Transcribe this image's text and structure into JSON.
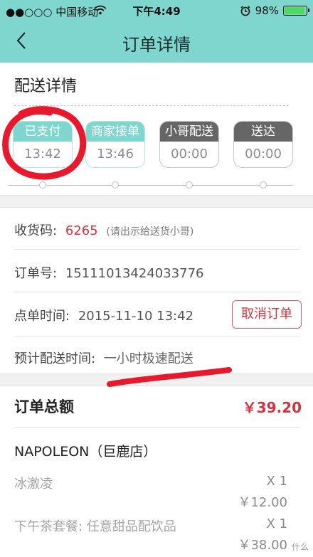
{
  "status_bar": {
    "carrier": "●●○○○ 中国移动",
    "time": "下午4:49",
    "battery_text": "98%",
    "battery_level": 0.98,
    "wifi_icon": "wifi-icon",
    "alarm_icon": "alarm-clock-icon"
  },
  "nav": {
    "title": "订单详情",
    "back_icon": "chevron-left-icon"
  },
  "delivery": {
    "section_title": "配送详情",
    "steps": [
      {
        "label": "已支付",
        "time": "13:42",
        "state": "done"
      },
      {
        "label": "商家接单",
        "time": "13:46",
        "state": "done"
      },
      {
        "label": "小哥配送",
        "time": "00:00",
        "state": "todo"
      },
      {
        "label": "送达",
        "time": "00:00",
        "state": "todo"
      }
    ]
  },
  "info": {
    "pickup_label": "收货码:",
    "pickup_code": "6265",
    "pickup_hint": "(请出示给送货小哥)",
    "order_no_label": "订单号:",
    "order_no": "15111013424033776",
    "order_time_label": "点单时间:",
    "order_time": "2015-11-10 13:42",
    "cancel_label": "取消订单",
    "eta_label": "预计配送时间:",
    "eta_value": "一小时极速配送"
  },
  "summary": {
    "total_label": "订单总额",
    "total_value": "￥39.20",
    "shop_name": "NAPOLEON（巨鹿店）",
    "items": [
      {
        "name": "冰激凌",
        "qty": "X 1",
        "price": "￥12.00"
      },
      {
        "name": "下午茶套餐: 任意甜品配饮品",
        "qty": "X 1",
        "price": "￥38.00"
      }
    ]
  },
  "watermark": "什么",
  "colors": {
    "accent": "#7fd6cf",
    "price_red": "#d8313f",
    "annotation_red": "#e8192c"
  }
}
